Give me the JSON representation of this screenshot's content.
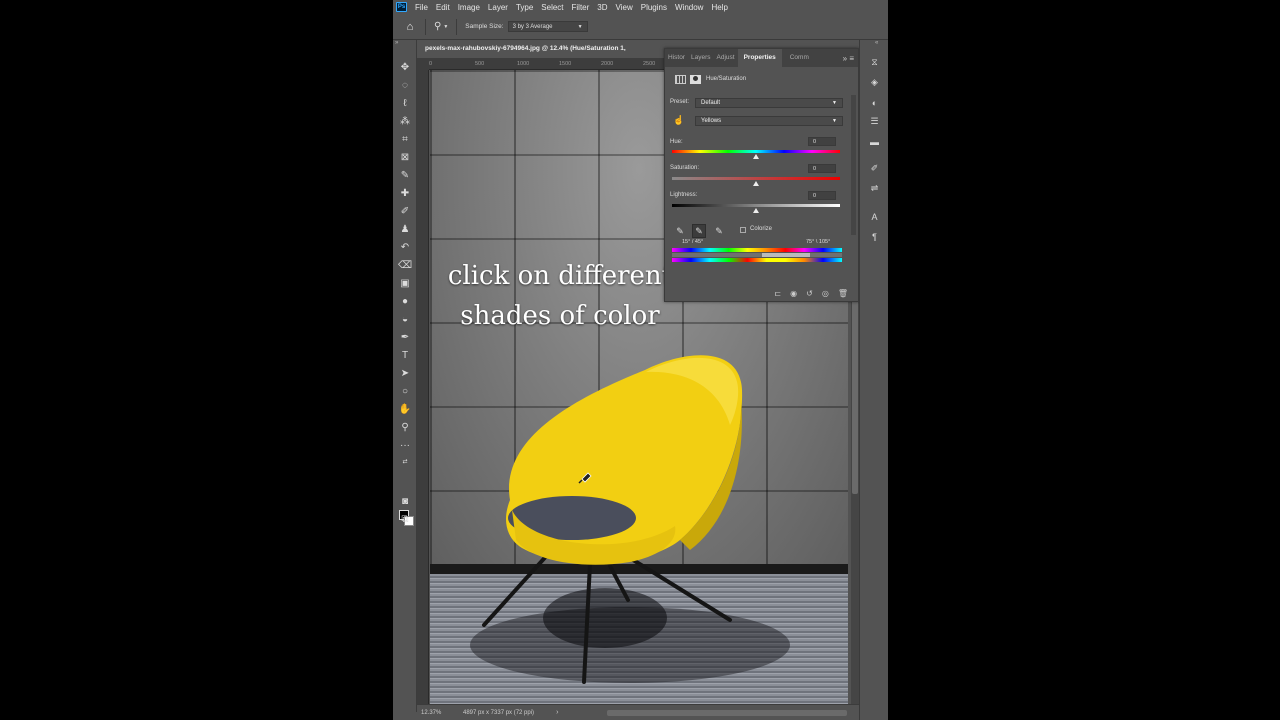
{
  "app": {
    "logo": "Ps",
    "menu": [
      "File",
      "Edit",
      "Image",
      "Layer",
      "Type",
      "Select",
      "Filter",
      "3D",
      "View",
      "Plugins",
      "Window",
      "Help"
    ]
  },
  "options": {
    "sample_size_label": "Sample Size:",
    "sample_size_value": "3 by 3 Average"
  },
  "document": {
    "tab_title": "pexels-max-rahubovskiy-6794964.jpg @ 12.4% (Hue/Saturation 1,",
    "ruler_ticks": [
      "0",
      "500",
      "1000",
      "1500",
      "2000",
      "2500"
    ],
    "overlay_line1": "click on different",
    "overlay_line2": "shades of color"
  },
  "status": {
    "zoom": "12.37%",
    "doc_size": "4897 px x 7337 px (72 ppi)",
    "arrow": "›"
  },
  "properties": {
    "tabs": [
      "Histor",
      "Layers",
      "Adjust",
      "Properties",
      "Comm"
    ],
    "active_tab": "Properties",
    "adjustment_title": "Hue/Saturation",
    "preset_label": "Preset:",
    "preset_value": "Default",
    "channel_value": "Yellows",
    "hue_label": "Hue:",
    "hue_value": "0",
    "saturation_label": "Saturation:",
    "saturation_value": "0",
    "lightness_label": "Lightness:",
    "lightness_value": "0",
    "colorize_label": "Colorize",
    "range_left": "15° / 45°",
    "range_right": "75° \\ 105°"
  },
  "colors": {
    "app_bg": "#535353",
    "panel_tab_bg": "#424242",
    "chair_yellow": "#f2cf12",
    "seat_cushion": "#4a4e5c"
  }
}
